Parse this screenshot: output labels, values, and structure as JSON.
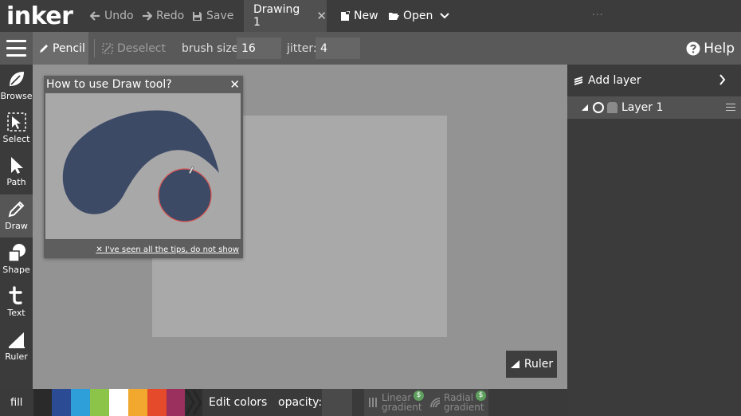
{
  "app": {
    "logo": "inker"
  },
  "topbar": {
    "undo": "Undo",
    "redo": "Redo",
    "save": "Save",
    "document_tab": "Drawing 1",
    "new": "New",
    "open": "Open",
    "more": "..."
  },
  "toolbar": {
    "active_tool": "Pencil",
    "deselect": "Deselect",
    "brush_size_label": "brush size:",
    "brush_size_value": "16",
    "jitter_label": "jitter:",
    "jitter_value": "4",
    "help": "Help"
  },
  "rail": {
    "tools": [
      {
        "label": "Browse",
        "icon": "leaf-icon"
      },
      {
        "label": "Select",
        "icon": "select-arrow-icon"
      },
      {
        "label": "Path",
        "icon": "path-arrow-icon"
      },
      {
        "label": "Draw",
        "icon": "pencil-icon",
        "active": true
      },
      {
        "label": "Shape",
        "icon": "shape-icon"
      },
      {
        "label": "Text",
        "icon": "text-icon"
      },
      {
        "label": "Ruler",
        "icon": "ruler-icon"
      }
    ]
  },
  "tip": {
    "title": "How to use Draw tool?",
    "dismiss": "I've seen all the tips, do not show"
  },
  "canvas": {
    "ruler_button": "Ruler"
  },
  "layers": {
    "add_layer": "Add layer",
    "items": [
      {
        "name": "Layer 1"
      }
    ]
  },
  "bottombar": {
    "fill_label": "fill",
    "swatches": [
      "#2b4c94",
      "#2e9fd9",
      "#8cc44a",
      "#ffffff",
      "#f2a82e",
      "#e54b2a",
      "#9b2f5e"
    ],
    "edit_colors": "Edit colors",
    "opacity_label": "opacity:",
    "linear_gradient": [
      "Linear",
      "gradient"
    ],
    "radial_gradient": [
      "Radial",
      "gradient"
    ],
    "premium_badge": "$"
  },
  "colors": {
    "accent_premium": "#5fa05f",
    "stroke_highlight": "#d9534f",
    "shape_fill": "#3c4a66"
  }
}
